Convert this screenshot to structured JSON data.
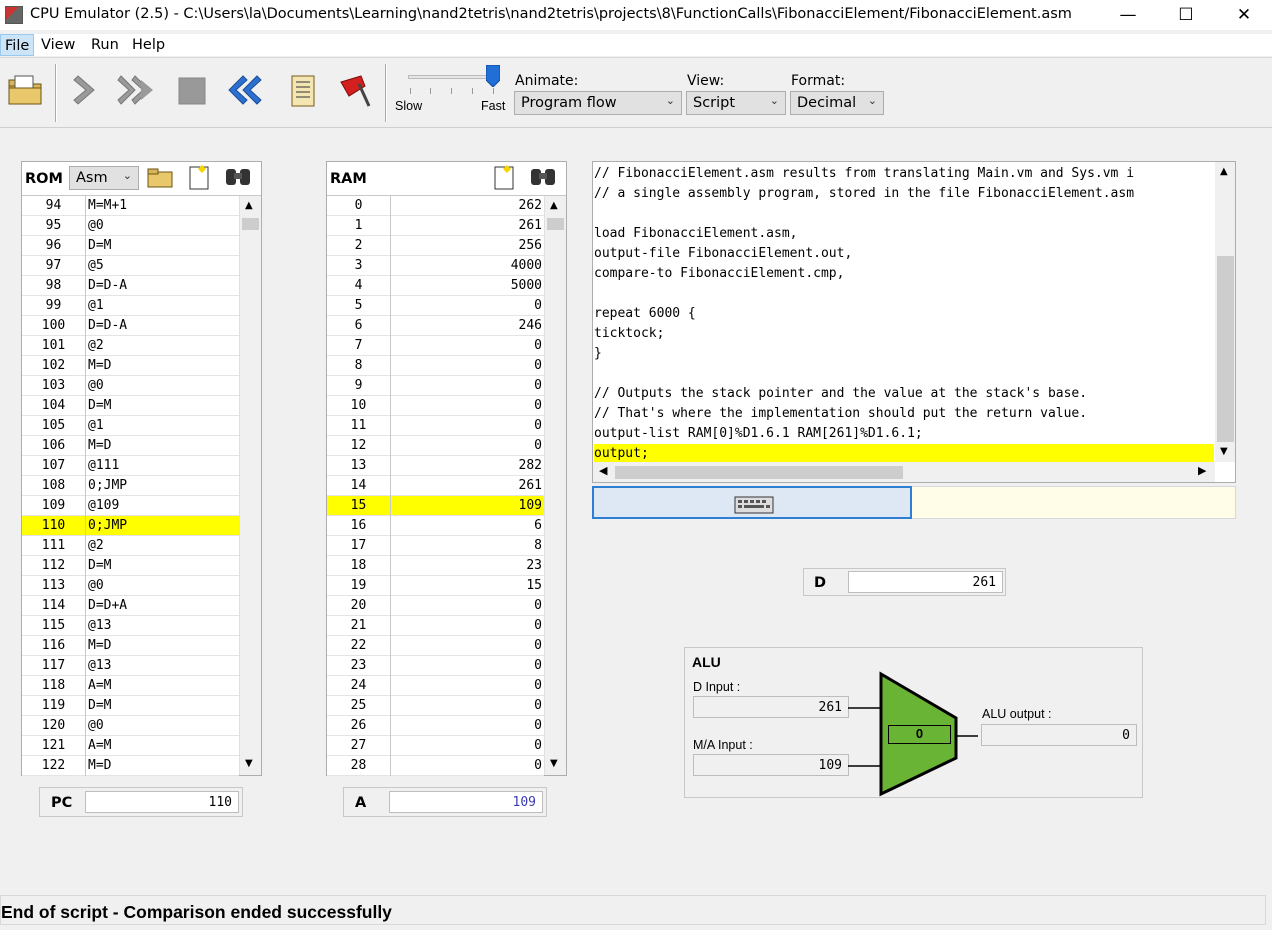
{
  "window": {
    "title": "CPU Emulator (2.5) - C:\\Users\\la\\Documents\\Learning\\nand2tetris\\nand2tetris\\projects\\8\\FunctionCalls\\FibonacciElement/FibonacciElement.asm",
    "minimize": "—",
    "maximize": "☐",
    "close": "✕"
  },
  "menu": {
    "file": "File",
    "view": "View",
    "run": "Run",
    "help": "Help"
  },
  "toolbar": {
    "speed_slow": "Slow",
    "speed_fast": "Fast",
    "speed_level": 1.0,
    "animate_label": "Animate:",
    "animate_value": "Program flow",
    "view_label": "View:",
    "view_value": "Script",
    "format_label": "Format:",
    "format_value": "Decimal",
    "icons": [
      "load-program-icon",
      "single-step-icon",
      "fast-forward-icon",
      "stop-icon",
      "rewind-icon",
      "script-icon",
      "breakpoints-icon"
    ]
  },
  "rom": {
    "label": "ROM",
    "format_value": "Asm",
    "rows": [
      [
        "94",
        "M=M+1"
      ],
      [
        "95",
        "@0"
      ],
      [
        "96",
        "D=M"
      ],
      [
        "97",
        "@5"
      ],
      [
        "98",
        "D=D-A"
      ],
      [
        "99",
        "@1"
      ],
      [
        "100",
        "D=D-A"
      ],
      [
        "101",
        "@2"
      ],
      [
        "102",
        "M=D"
      ],
      [
        "103",
        "@0"
      ],
      [
        "104",
        "D=M"
      ],
      [
        "105",
        "@1"
      ],
      [
        "106",
        "M=D"
      ],
      [
        "107",
        "@111"
      ],
      [
        "108",
        "0;JMP"
      ],
      [
        "109",
        "@109"
      ],
      [
        "110",
        "0;JMP"
      ],
      [
        "111",
        "@2"
      ],
      [
        "112",
        "D=M"
      ],
      [
        "113",
        "@0"
      ],
      [
        "114",
        "D=D+A"
      ],
      [
        "115",
        "@13"
      ],
      [
        "116",
        "M=D"
      ],
      [
        "117",
        "@13"
      ],
      [
        "118",
        "A=M"
      ],
      [
        "119",
        "D=M"
      ],
      [
        "120",
        "@0"
      ],
      [
        "121",
        "A=M"
      ],
      [
        "122",
        "M=D"
      ]
    ],
    "highlight": "110"
  },
  "ram": {
    "label": "RAM",
    "rows": [
      [
        "0",
        "262"
      ],
      [
        "1",
        "261"
      ],
      [
        "2",
        "256"
      ],
      [
        "3",
        "4000"
      ],
      [
        "4",
        "5000"
      ],
      [
        "5",
        "0"
      ],
      [
        "6",
        "246"
      ],
      [
        "7",
        "0"
      ],
      [
        "8",
        "0"
      ],
      [
        "9",
        "0"
      ],
      [
        "10",
        "0"
      ],
      [
        "11",
        "0"
      ],
      [
        "12",
        "0"
      ],
      [
        "13",
        "282"
      ],
      [
        "14",
        "261"
      ],
      [
        "15",
        "109"
      ],
      [
        "16",
        "6"
      ],
      [
        "17",
        "8"
      ],
      [
        "18",
        "23"
      ],
      [
        "19",
        "15"
      ],
      [
        "20",
        "0"
      ],
      [
        "21",
        "0"
      ],
      [
        "22",
        "0"
      ],
      [
        "23",
        "0"
      ],
      [
        "24",
        "0"
      ],
      [
        "25",
        "0"
      ],
      [
        "26",
        "0"
      ],
      [
        "27",
        "0"
      ],
      [
        "28",
        "0"
      ]
    ],
    "highlight": "15"
  },
  "registers": {
    "pc_label": "PC",
    "pc_value": "110",
    "a_label": "A",
    "a_value": "109",
    "d_label": "D",
    "d_value": "261"
  },
  "script": {
    "lines": [
      "// FibonacciElement.asm results from translating Main.vm and Sys.vm i",
      "// a single assembly program, stored in the file FibonacciElement.asm",
      "",
      "load FibonacciElement.asm,",
      "output-file FibonacciElement.out,",
      "compare-to FibonacciElement.cmp,",
      "",
      "repeat 6000 {",
      "ticktock;",
      "}",
      "",
      "// Outputs the stack pointer and the value at the stack's base.",
      "// That's where the implementation should put the return value.",
      "output-list RAM[0]%D1.6.1 RAM[261]%D1.6.1;",
      "output;"
    ],
    "highlight_index": 14
  },
  "alu": {
    "title": "ALU",
    "d_input_label": "D Input :",
    "d_input_value": "261",
    "ma_input_label": "M/A Input :",
    "ma_input_value": "109",
    "output_label": "ALU output :",
    "output_value": "0",
    "center_value": "0",
    "color": "#6ab435"
  },
  "status": {
    "message": "End of script - Comparison ended successfully"
  }
}
